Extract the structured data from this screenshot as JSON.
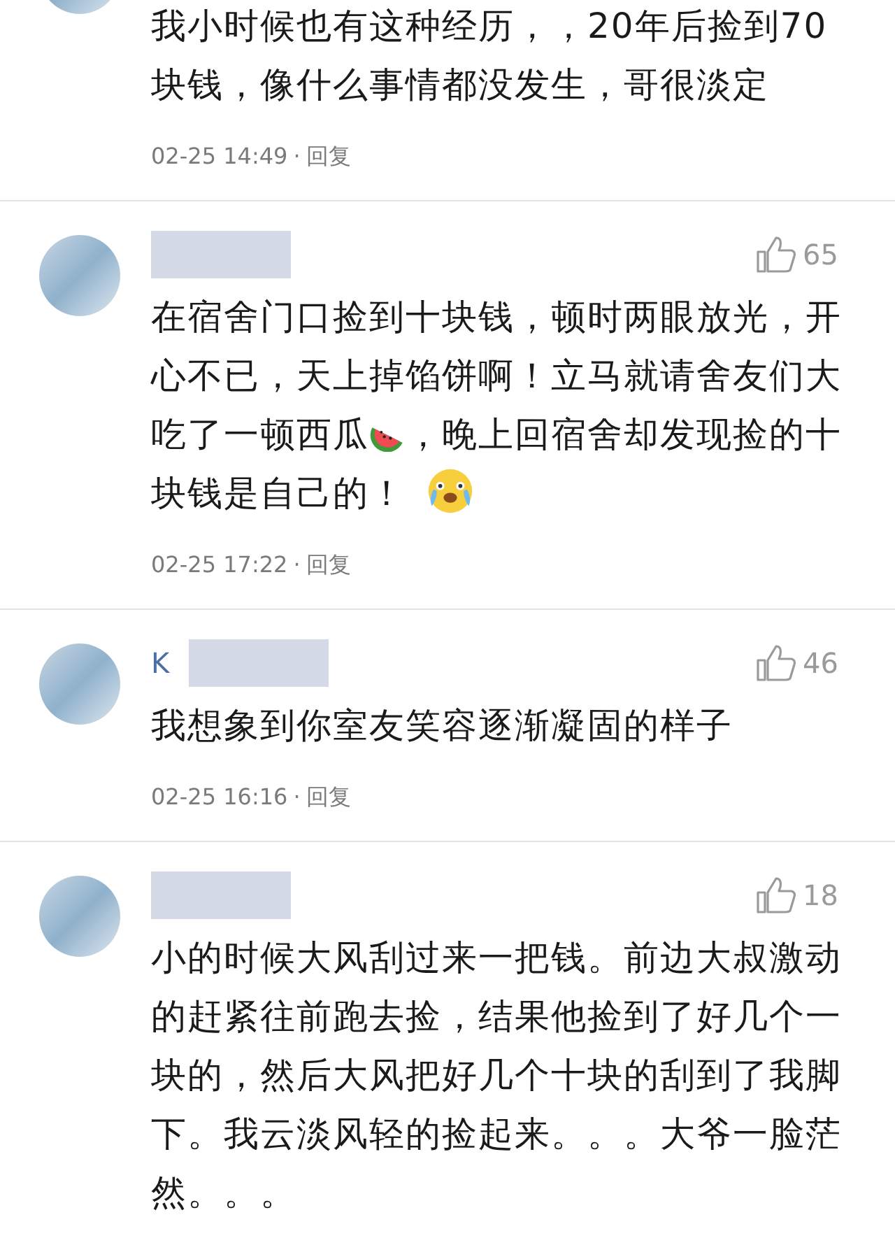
{
  "comments": [
    {
      "segments": [
        {
          "kind": "text",
          "text": "我小时候也有这种经历，，20年后捡到70块钱，像什么事情都没发生，哥很淡定"
        }
      ],
      "time": "02-25 14:49",
      "separator": "·",
      "reply": "回复"
    },
    {
      "name_redacted": true,
      "likes": "65",
      "segments": [
        {
          "kind": "text",
          "text": "在宿舍门口捡到十块钱，顿时两眼放光，开心不已，天上掉馅饼啊！立马就请舍友们大吃了一顿西瓜"
        },
        {
          "kind": "watermelon"
        },
        {
          "kind": "text",
          "text": "，晚上回宿舍却发现捡的十块钱是自己的！"
        },
        {
          "kind": "laugh_cry"
        }
      ],
      "time": "02-25 17:22",
      "separator": "·",
      "reply": "回复"
    },
    {
      "name": "K",
      "name_redacted": true,
      "likes": "46",
      "segments": [
        {
          "kind": "text",
          "text": "我想象到你室友笑容逐渐凝固的样子"
        }
      ],
      "time": "02-25 16:16",
      "separator": "·",
      "reply": "回复"
    },
    {
      "name_redacted": true,
      "likes": "18",
      "segments": [
        {
          "kind": "text",
          "text": "小的时候大风刮过来一把钱。前边大叔激动的赶紧往前跑去捡，结果他捡到了好几个一块的，然后大风把好几个十块的刮到了我脚下。我云淡风轻的捡起来。。。大爷一脸茫然。。。"
        }
      ]
    }
  ]
}
